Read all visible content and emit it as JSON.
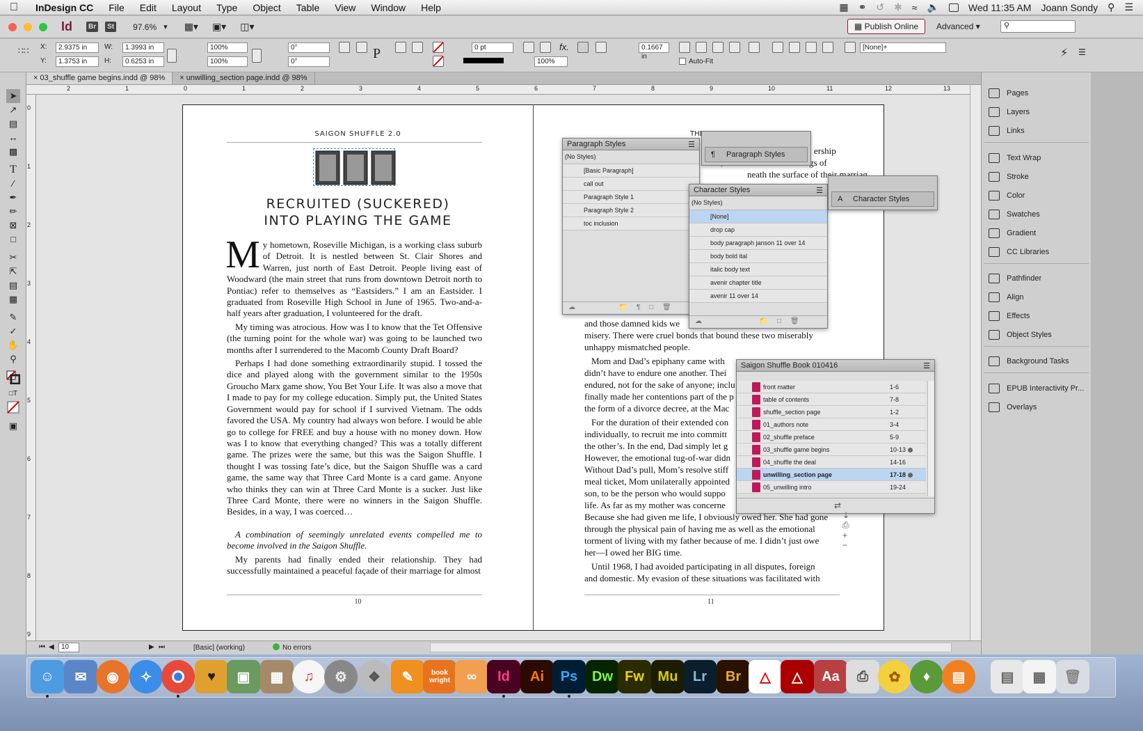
{
  "menubar": {
    "app": "InDesign CC",
    "items": [
      "File",
      "Edit",
      "Layout",
      "Type",
      "Object",
      "Table",
      "View",
      "Window",
      "Help"
    ],
    "clock": "Wed 11:35 AM",
    "user": "Joann Sondy"
  },
  "appbar": {
    "logo": "Id",
    "br": "Br",
    "st": "St",
    "zoom": "97.6%",
    "publish": "Publish Online",
    "workspace": "Advanced"
  },
  "control": {
    "x": "2.9375 in",
    "y": "1.3753 in",
    "w": "1.3993 in",
    "h": "0.6253 in",
    "scale_x": "100%",
    "scale_y": "100%",
    "rotate": "0°",
    "shear": "0°",
    "stroke": "0 pt",
    "opacity": "100%",
    "offset": "0.1667 in",
    "autofit": "Auto-Fit",
    "object_style": "[None]+"
  },
  "tabs": [
    {
      "label": "03_shuffle game begins.indd @ 98%"
    },
    {
      "label": "unwilling_section page.indd @ 98%"
    }
  ],
  "ruler": {
    "h": [
      "2",
      "1",
      "0",
      "1",
      "2",
      "3",
      "4",
      "5",
      "6",
      "7",
      "8",
      "9",
      "10",
      "11",
      "12",
      "13"
    ],
    "v": [
      "0",
      "1",
      "2",
      "3",
      "4",
      "5",
      "6",
      "7",
      "8",
      "9"
    ]
  },
  "left_page": {
    "running_head": "SAIGON SHUFFLE 2.0",
    "title1": "RECRUITED (SUCKERED)",
    "title2": "INTO PLAYING THE GAME",
    "dropcap": "M",
    "p1": "y hometown, Roseville Michigan, is a working class suburb of Detroit. It is nestled between St. Clair Shores and Warren, just north of East Detroit. People living east of Woodward (the main street that runs from downtown Detroit north to Pontiac) refer to themselves as “Eastsiders.” I am an Eastsider. I graduated from Roseville High School in June of 1965. Two-and-a-half years after graduation, I volunteered for the draft.",
    "p2": "My timing was atrocious. How was I to know that the Tet Offensive (the turning point for the whole war) was going to be launched two months after I surrendered to the Macomb County Draft Board?",
    "p3": "Perhaps I had done something extraordinarily stupid. I tossed the dice and played along with the government similar to the 1950s Groucho Marx game show, You Bet Your Life. It was also a move that I made to pay for my college education. Simply put, the United States Government would pay for school if I survived Vietnam. The odds favored the USA. My country had always won before. I would be able go to college for FREE and buy a house with no money down. How was I to know that everything changed? This was a totally different game. The prizes were the same, but this was the Saigon Shuffle. I thought I was tossing fate’s dice, but the Saigon Shuffle was a card game, the same way that Three Card Monte is a card game. Anyone who thinks they can win at Three Card Monte is a sucker. Just like Three Card Monte, there were no winners in the Saigon Shuffle. Besides, in a way, I was coerced…",
    "callout": "A combination of seemingly unrelated events compelled me to become involved in the Saigon Shuffle.",
    "p4": "My parents had finally ended their relationship. They had successfully maintained a peaceful façade of their marriage for almost",
    "folio": "10"
  },
  "right_page": {
    "running_head": "THE",
    "l1": "ership",
    "l2": "child, I had known that feelings of",
    "l3": "neath the surface of their marriag",
    "l4": "and those damned kids we",
    "l5": "misery. There were cruel bonds that bound these two miserably",
    "l6": "unhappy mismatched people.",
    "l7": "Mom and Dad’s epiphany came with",
    "l8": "didn’t have to endure one another. Thei",
    "l9": "endured, not for the sake of anyone; inclu",
    "l10": "finally made her contentions part of the p",
    "l11": "the form of a divorce decree, at the Mac",
    "l12": "For the duration of their extended con",
    "l13": "individually, to recruit me into committ",
    "l14": "the other’s. In the end, Dad simply let g",
    "l15": "However, the emotional tug-of-war didn",
    "l16": "Without Dad’s pull, Mom’s resolve stiff",
    "l17": "meal ticket, Mom unilaterally appointed",
    "l18": "son, to be the person who would suppo",
    "l19": "life. As far as my mother was concerne",
    "l20": "Because she had given me life, I obviously owed her. She had gone",
    "l21": "through the physical pain of having me as well as the emotional",
    "l22": "torment of living with my father because of me. I didn’t just owe",
    "l23": "her—I owed her BIG time.",
    "l24": "Until 1968, I had avoided participating in all disputes, foreign",
    "l25": "and domestic. My evasion of these situations was facilitated with",
    "folio": "11"
  },
  "para_panel": {
    "title": "Paragraph Styles",
    "current": "(No Styles)",
    "items": [
      "[Basic Paragraph]",
      "call out",
      "Paragraph Style 1",
      "Paragraph Style 2",
      "toc inclusion"
    ],
    "collapsed_label": "Paragraph Styles"
  },
  "char_panel": {
    "title": "Character Styles",
    "current": "(No Styles)",
    "items": [
      "[None]",
      "drop cap",
      "body paragraph janson 11 over 14",
      "body bold ital",
      "italic body text",
      "avenir chapter title",
      "avenir 11 over 14"
    ],
    "collapsed_label": "Character Styles"
  },
  "book_panel": {
    "title": "Saigon Shuffle Book 010416",
    "rows": [
      {
        "name": "front matter",
        "pages": "1-6"
      },
      {
        "name": "table of contents",
        "pages": "7-8"
      },
      {
        "name": "shuffle_section page",
        "pages": "1-2"
      },
      {
        "name": "01_authors note",
        "pages": "3-4"
      },
      {
        "name": "02_shuffle preface",
        "pages": "5-9"
      },
      {
        "name": "03_shuffle game begins",
        "pages": "10-13"
      },
      {
        "name": "04_shuffle the deal",
        "pages": "14-16"
      },
      {
        "name": "unwilling_section page",
        "pages": "17-18"
      },
      {
        "name": "05_unwilling intro",
        "pages": "19-24"
      }
    ]
  },
  "dock_panels": {
    "group1": [
      "Pages",
      "Layers",
      "Links"
    ],
    "group2": [
      "Text Wrap",
      "Stroke",
      "Color",
      "Swatches",
      "Gradient",
      "CC Libraries"
    ],
    "group3": [
      "Pathfinder",
      "Align",
      "Effects",
      "Object Styles"
    ],
    "group4": [
      "Background Tasks"
    ],
    "group5": [
      "EPUB Interactivity Pr...",
      "Overlays"
    ]
  },
  "status": {
    "page": "10",
    "profile": "[Basic] (working)",
    "preflight": "No errors"
  },
  "macdock": [
    "Finder",
    "Thunderbird",
    "Firefox",
    "Safari",
    "Chrome",
    "Transmit",
    "Preview",
    "Calculator",
    "iTunes",
    "System Preferences",
    "Disk Utility",
    "Pages",
    "book wright",
    "Acrobat",
    "Id",
    "Ai",
    "Ps",
    "Dw",
    "Fw",
    "Mu",
    "Lr",
    "Br",
    "Acrobat Reader",
    "Acrobat Pro",
    "Dictionary",
    "Printer",
    "Cyberduck",
    "Evernote",
    "iBooks",
    "Documents",
    "Downloads",
    "Trash"
  ],
  "colors": {
    "accent": "#4a90e2",
    "selection": "#bcd5f0",
    "id_pink": "#c2185b"
  }
}
